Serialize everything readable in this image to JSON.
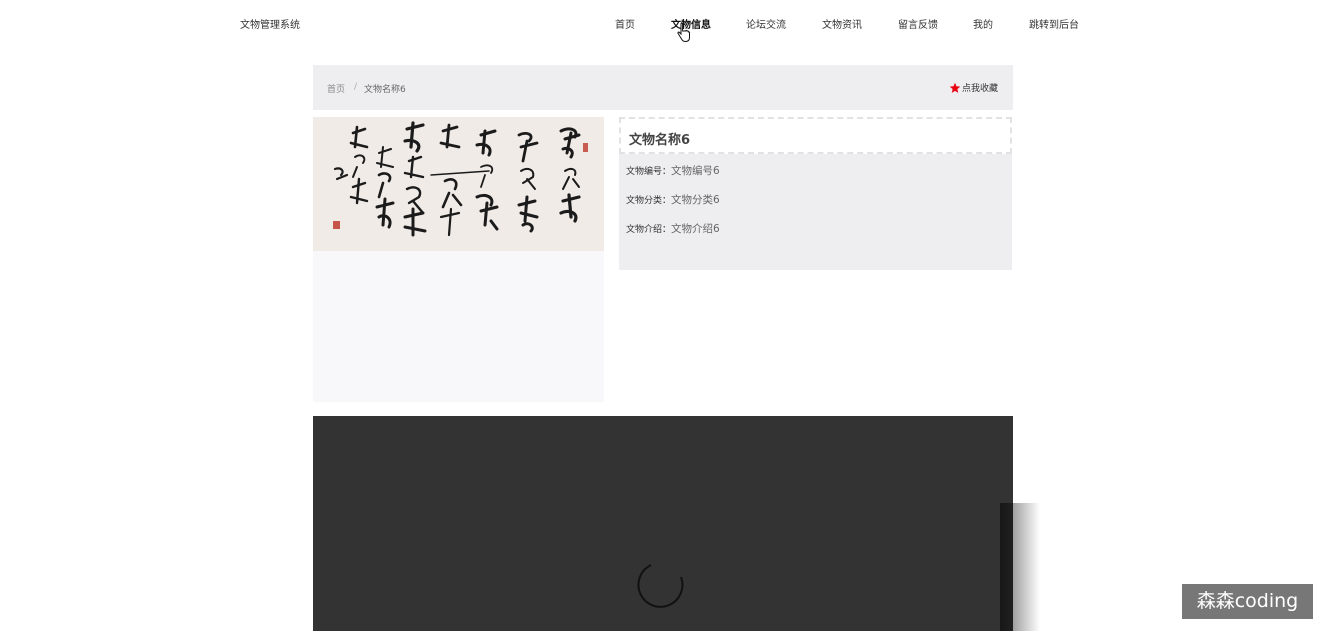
{
  "header": {
    "brand": "文物管理系统",
    "nav": [
      {
        "label": "首页",
        "active": false
      },
      {
        "label": "文物信息",
        "active": true
      },
      {
        "label": "论坛交流",
        "active": false
      },
      {
        "label": "文物资讯",
        "active": false
      },
      {
        "label": "留言反馈",
        "active": false
      },
      {
        "label": "我的",
        "active": false
      },
      {
        "label": "跳转到后台",
        "active": false
      }
    ]
  },
  "breadcrumb": {
    "home": "首页",
    "separator": "/",
    "current": "文物名称6"
  },
  "favorite": {
    "label": "点我收藏",
    "icon": "star-icon",
    "color": "#e60012"
  },
  "detail": {
    "title": "文物名称6",
    "fields": [
      {
        "label": "文物编号：",
        "value": "文物编号6"
      },
      {
        "label": "文物分类：",
        "value": "文物分类6"
      },
      {
        "label": "文物介绍：",
        "value": "文物介绍6"
      }
    ]
  },
  "video": {
    "background": "#333333",
    "state": "loading"
  },
  "watermark": "森森coding"
}
